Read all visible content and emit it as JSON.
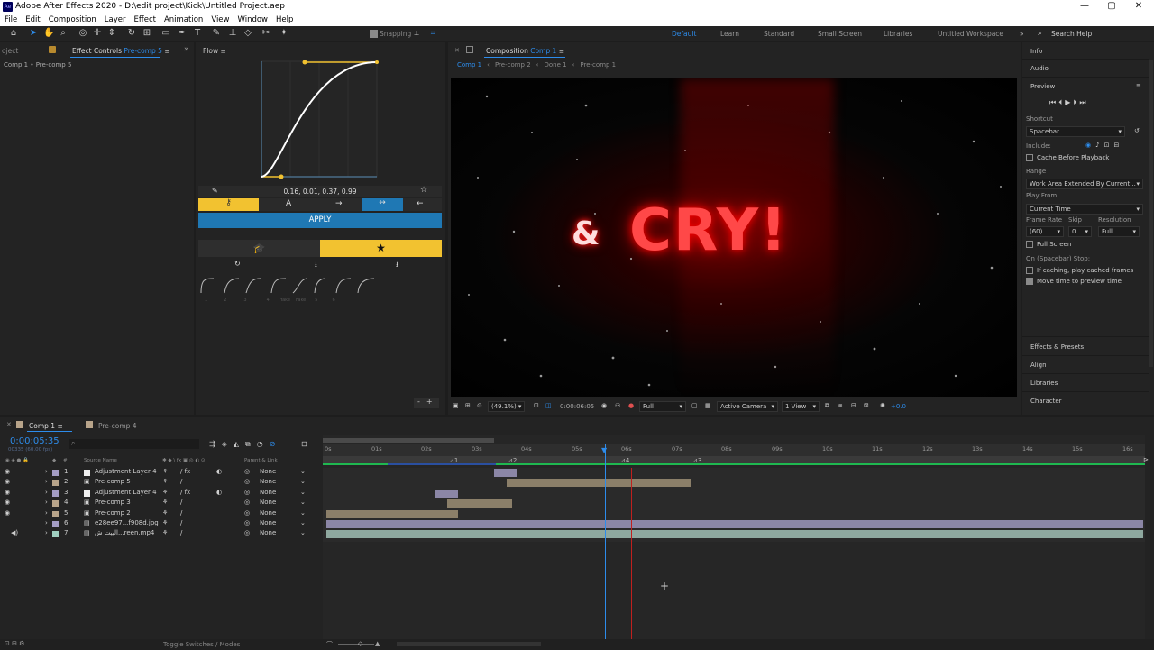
{
  "app": {
    "title": "Adobe After Effects 2020 - D:\\edit project\\Kick\\Untitled Project.aep",
    "logo": "Ae"
  },
  "menu": [
    "File",
    "Edit",
    "Composition",
    "Layer",
    "Effect",
    "Animation",
    "View",
    "Window",
    "Help"
  ],
  "toolbar": {
    "snapping": "Snapping",
    "workspaces": [
      "Default",
      "Learn",
      "Standard",
      "Small Screen",
      "Libraries",
      "Untitled Workspace"
    ],
    "search_placeholder": "Search Help"
  },
  "left_panel": {
    "tab_project": "oject",
    "tab": "Effect Controls",
    "tab_target": "Pre-comp 5",
    "breadcrumb": "Comp 1 • Pre-comp 5"
  },
  "flow": {
    "tab": "Flow",
    "values": "0.16, 0.01, 0.37, 0.99",
    "apply": "APPLY",
    "presets": [
      "1",
      "2",
      "3",
      "4",
      "Yake",
      "Fake",
      "5",
      "6"
    ]
  },
  "comp": {
    "tab": "Composition",
    "tab_target": "Comp 1",
    "nav": [
      "Comp 1",
      "Pre-comp 2",
      "Done 1",
      "Pre-comp 1"
    ],
    "text_main": "CRY!",
    "text_amp": "&",
    "zoom": "(49.1%)",
    "time": "0:00:06:05",
    "quality": "Full",
    "camera": "Active Camera",
    "view": "1 View",
    "exposure": "+0.0"
  },
  "right_panel": {
    "info": "Info",
    "audio": "Audio",
    "preview": "Preview",
    "shortcut_label": "Shortcut",
    "shortcut": "Spacebar",
    "include": "Include:",
    "cache": "Cache Before Playback",
    "range_label": "Range",
    "range": "Work Area Extended By Current...",
    "play_from_label": "Play From",
    "play_from": "Current Time",
    "frame_rate_label": "Frame Rate",
    "skip_label": "Skip",
    "resolution_label": "Resolution",
    "frame_rate": "(60)",
    "skip": "0",
    "resolution": "Full",
    "full_screen": "Full Screen",
    "on_stop": "On (Spacebar) Stop:",
    "if_caching": "If caching, play cached frames",
    "move_time": "Move time to preview time",
    "effects": "Effects & Presets",
    "align": "Align",
    "libraries": "Libraries",
    "character": "Character"
  },
  "timeline": {
    "tab1": "Comp 1",
    "tab2": "Pre-comp 4",
    "timecode": "0:00:05:35",
    "fps": "00335 (60.00 fps)",
    "col_source": "Source Name",
    "col_parent": "Parent & Link",
    "ruler": [
      "0s",
      "01s",
      "02s",
      "03s",
      "04s",
      "05s",
      "06s",
      "07s",
      "08s",
      "09s",
      "10s",
      "11s",
      "12s",
      "13s",
      "14s",
      "15s",
      "16s"
    ],
    "layers": [
      {
        "num": "1",
        "name": "Adjustment Layer 4",
        "parent": "None",
        "color": "#a39cc4"
      },
      {
        "num": "2",
        "name": "Pre-comp 5",
        "parent": "None",
        "color": "#b8a48a"
      },
      {
        "num": "3",
        "name": "Adjustment Layer 4",
        "parent": "None",
        "color": "#a39cc4"
      },
      {
        "num": "4",
        "name": "Pre-comp 3",
        "parent": "None",
        "color": "#b8a48a"
      },
      {
        "num": "5",
        "name": "Pre-comp 2",
        "parent": "None",
        "color": "#b8a48a"
      },
      {
        "num": "6",
        "name": "e28ee97...f908d.jpg",
        "parent": "None",
        "color": "#a39cc4"
      },
      {
        "num": "7",
        "name": "البيت ش...reen.mp4",
        "parent": "None",
        "color": "#9fcfc0"
      }
    ],
    "toggle": "Toggle Switches / Modes"
  }
}
